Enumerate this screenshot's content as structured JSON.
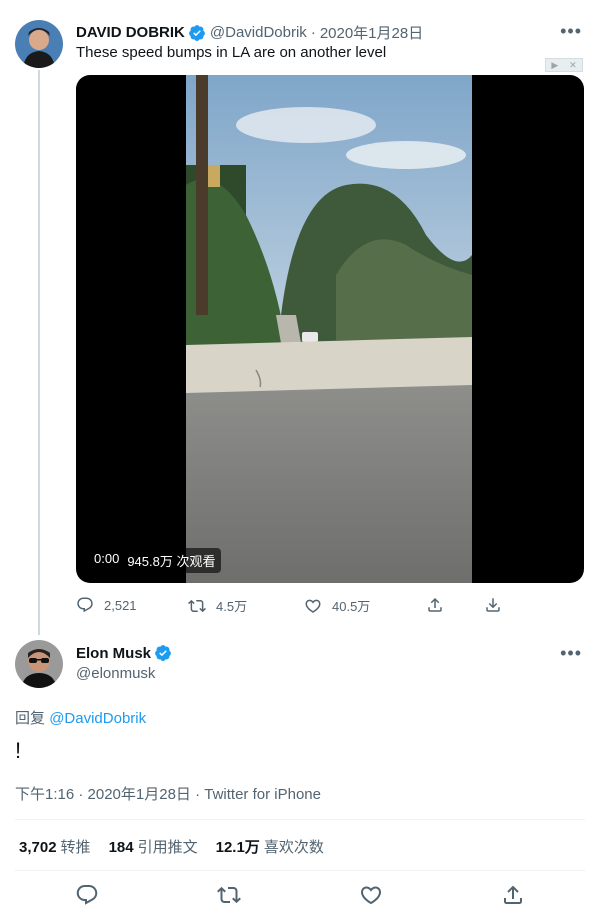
{
  "quoted_tweet": {
    "display_name": "DAVID DOBRIK",
    "handle": "@DavidDobrik",
    "separator": "·",
    "date": "2020年1月28日",
    "text": "These speed bumps in LA are on another level",
    "media": {
      "time": "0:00",
      "views": "945.8万 次观看"
    },
    "actions": {
      "replies": "2,521",
      "retweets": "4.5万",
      "likes": "40.5万"
    }
  },
  "main_tweet": {
    "display_name": "Elon Musk",
    "handle": "@elonmusk",
    "reply_prefix": "回复",
    "reply_to": "@DavidDobrik",
    "text": "!",
    "meta": "下午1:16 · 2020年1月28日 · Twitter for iPhone",
    "stats": {
      "retweets_count": "3,702",
      "retweets_label": "转推",
      "quotes_count": "184",
      "quotes_label": "引用推文",
      "likes_count": "12.1万",
      "likes_label": "喜欢次数"
    }
  },
  "colors": {
    "accent": "#1d9bf0",
    "text_primary": "#0f1419",
    "text_secondary": "#536471",
    "divider": "#eff3f4"
  },
  "icons": [
    "more-icon",
    "verified-icon",
    "reply-icon",
    "retweet-icon",
    "like-icon",
    "share-icon",
    "download-icon"
  ]
}
